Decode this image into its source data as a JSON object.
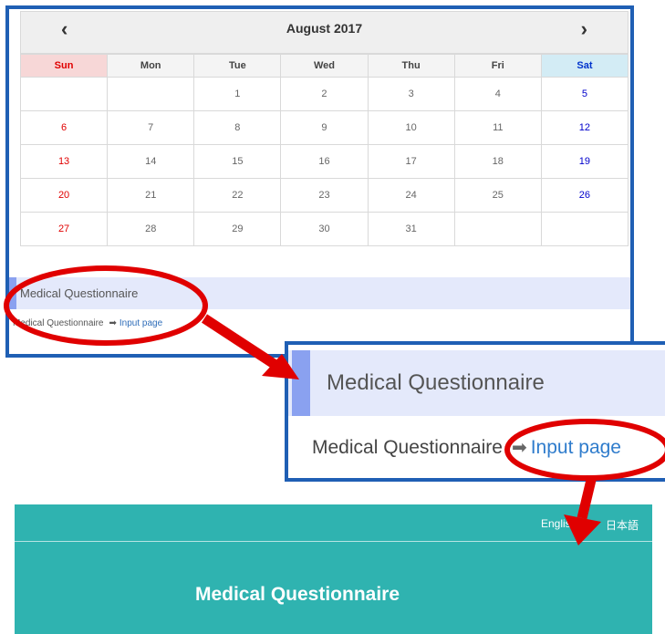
{
  "calendar": {
    "prev_icon": "‹",
    "next_icon": "›",
    "month_title": "August 2017",
    "weekdays": [
      "Sun",
      "Mon",
      "Tue",
      "Wed",
      "Thu",
      "Fri",
      "Sat"
    ],
    "weeks": [
      [
        "",
        "",
        "1",
        "2",
        "3",
        "4",
        "5"
      ],
      [
        "6",
        "7",
        "8",
        "9",
        "10",
        "11",
        "12"
      ],
      [
        "13",
        "14",
        "15",
        "16",
        "17",
        "18",
        "19"
      ],
      [
        "20",
        "21",
        "22",
        "23",
        "24",
        "25",
        "26"
      ],
      [
        "27",
        "28",
        "29",
        "30",
        "31",
        "",
        ""
      ]
    ]
  },
  "section": {
    "title": "Medical Questionnaire",
    "line_label": "Medical Questionnaire",
    "arrow_icon": "➡",
    "link_label": "Input page"
  },
  "zoom": {
    "title": "Medical Questionnaire",
    "line_label": "Medical Questionnaire",
    "arrow_icon": "➡",
    "link_label": "Input page"
  },
  "teal_header": {
    "lang_english": "English",
    "lang_japanese": "日本語",
    "title": "Medical Questionnaire"
  },
  "colors": {
    "frame_blue": "#1f5fb4",
    "annotation_red": "#e00000",
    "teal": "#2fb3b0",
    "accent_bar": "#8aa1f0",
    "link_blue": "#2f6db9"
  }
}
